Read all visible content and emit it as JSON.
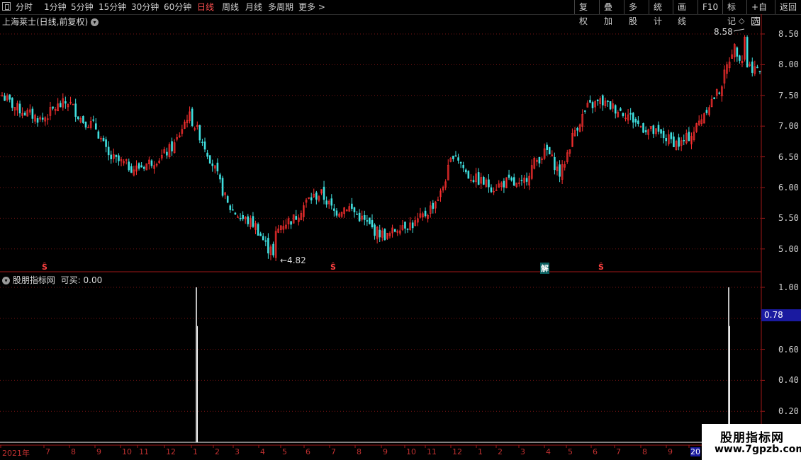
{
  "toolbar": {
    "periods": [
      {
        "label": "分时",
        "active": false
      },
      {
        "label": "1分钟",
        "active": false
      },
      {
        "label": "5分钟",
        "active": false
      },
      {
        "label": "15分钟",
        "active": false
      },
      {
        "label": "30分钟",
        "active": false
      },
      {
        "label": "60分钟",
        "active": false
      },
      {
        "label": "日线",
        "active": true
      },
      {
        "label": "周线",
        "active": false
      },
      {
        "label": "月线",
        "active": false
      },
      {
        "label": "多周期",
        "active": false
      },
      {
        "label": "更多 >",
        "active": false
      }
    ],
    "right_buttons": [
      "复权",
      "叠加",
      "多股",
      "统计",
      "画线",
      "F10",
      "标记",
      "+自选",
      "返回"
    ]
  },
  "main_chart": {
    "title": "上海莱士(日线,前复权)",
    "price_axis": [
      "8.50",
      "8.00",
      "7.50",
      "7.00",
      "6.50",
      "6.00",
      "5.50",
      "5.00"
    ],
    "high_label": "8.58",
    "low_label": "←4.82",
    "signal_marks": [
      "Ŝ",
      "Ŝ",
      "解",
      "Ŝ"
    ],
    "colors": {
      "up": "#ff3030",
      "down": "#40e0e0",
      "grid": "#8b1a1a",
      "axis": "#c0c0c0"
    }
  },
  "indicator": {
    "title": "股朋指标网",
    "label": "可买: 0.00",
    "value_box": "0.78",
    "axis": [
      "1.00",
      "0.80",
      "0.60",
      "0.40",
      "0.20"
    ]
  },
  "date_axis": [
    "2021年",
    "7",
    "8",
    "9",
    "10",
    "11",
    "12",
    "1",
    "2",
    "3",
    "4",
    "5",
    "6",
    "7",
    "8",
    "9",
    "10",
    "11",
    "12",
    "1",
    "2",
    "3",
    "4",
    "5",
    "6",
    "7",
    "8",
    "9",
    "20"
  ],
  "watermark": {
    "title": "股朋指标网",
    "url": "www.7gpzb.com"
  },
  "chart_data": {
    "type": "candlestick",
    "title": "上海莱士(日线,前复权)",
    "ylim": [
      4.75,
      8.7
    ],
    "close_approx": [
      7.5,
      7.3,
      7.2,
      7.1,
      7.3,
      7.4,
      7.1,
      7.0,
      6.5,
      6.4,
      6.3,
      6.4,
      6.5,
      6.7,
      7.2,
      6.8,
      6.3,
      5.7,
      5.5,
      5.4,
      5.0,
      5.4,
      5.5,
      5.8,
      5.9,
      5.6,
      5.7,
      5.5,
      5.3,
      5.2,
      5.4,
      5.4,
      5.6,
      5.9,
      6.6,
      6.2,
      6.1,
      6.0,
      6.1,
      6.0,
      6.4,
      6.6,
      6.2,
      6.9,
      7.3,
      7.4,
      7.3,
      7.2,
      7.0,
      6.9,
      6.8,
      6.7,
      6.9,
      7.3,
      7.6,
      8.3,
      8.0,
      7.9
    ],
    "high_marker": 8.58,
    "low_marker": 4.82,
    "indicator_series": {
      "name": "可买",
      "spikes": [
        {
          "position": "2021-01",
          "value": 1.0
        },
        {
          "position": "2022-20xx",
          "value": 1.0
        }
      ],
      "current": 0.0,
      "ylim": [
        0,
        1.05
      ]
    }
  }
}
